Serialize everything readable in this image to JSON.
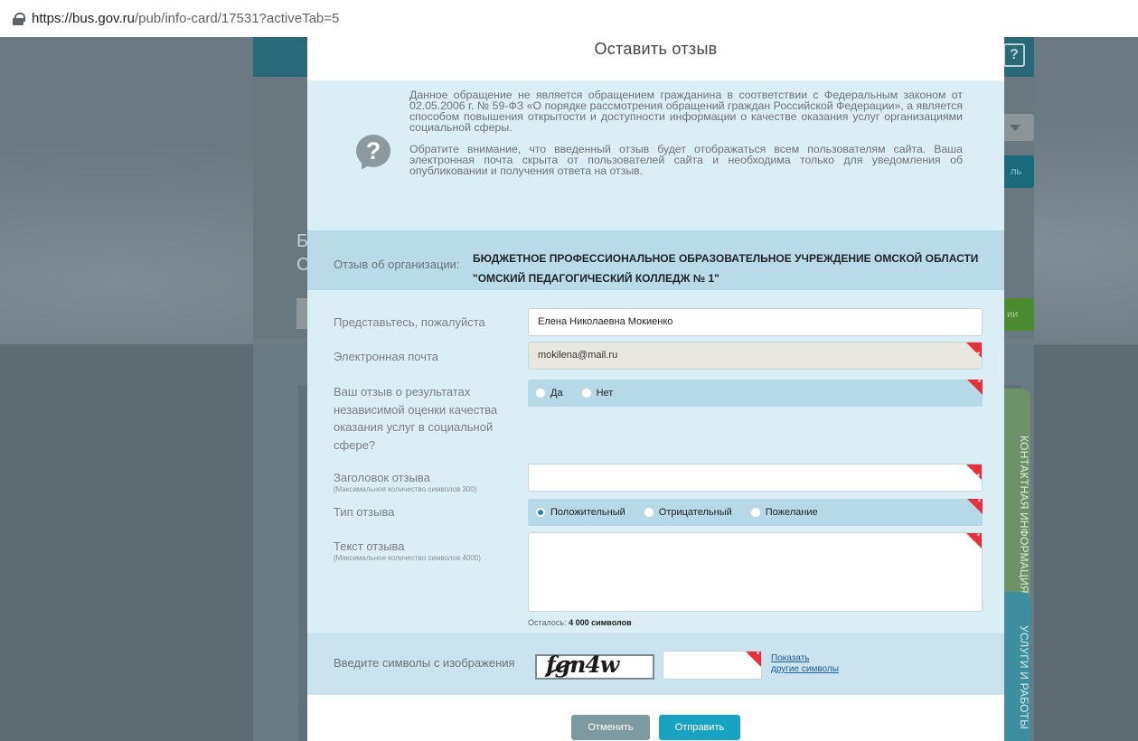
{
  "browser": {
    "url_host": "https://bus.gov.ru",
    "url_path": "/pub/info-card/17531?activeTab=5"
  },
  "background": {
    "letters": "Б\nС",
    "button_fragment_1": "ль",
    "button_fragment_2": "ии",
    "side_tabs": [
      "КОНТАКТНАЯ ИНФОРМАЦИЯ",
      "УСЛУГИ И РАБОТЫ"
    ]
  },
  "modal": {
    "title": "Оставить отзыв",
    "notice": {
      "paragraph_1": "Данное обращение не является обращением гражданина в соответствии с Федеральным законом от 02.05.2006 г. № 59-ФЗ «О порядке рассмотрения обращений граждан Российской Федерации», а является способом повышения открытости и доступности информации о качестве оказания услуг организациями социальной сферы.",
      "paragraph_2": "Обратите внимание, что введенный отзыв будет отображаться всем пользователям сайта. Ваша электронная почта скрыта от пользователей сайта и необходима только для уведомления об опубликовании и получения ответа на отзыв."
    },
    "organization": {
      "label": "Отзыв об организации:",
      "line_1": "БЮДЖЕТНОЕ ПРОФЕССИОНАЛЬНОЕ ОБРАЗОВАТЕЛЬНОЕ УЧРЕЖДЕНИЕ ОМСКОЙ ОБЛАСТИ",
      "line_2": "\"ОМСКИЙ ПЕДАГОГИЧЕСКИЙ КОЛЛЕДЖ № 1\""
    },
    "form": {
      "name_label": "Представьтесь, пожалуйста",
      "name_value": "Елена Николаевна Мокиенко",
      "email_label": "Электронная почта",
      "email_value": "mokilena@mail.ru",
      "independent_label": "Ваш отзыв о результатах независимой оценки качества оказания услуг в социальной сфере?",
      "independent_options": [
        "Да",
        "Нет"
      ],
      "title_label": "Заголовок отзыва",
      "title_hint": "(Максимальное количество символов 300)",
      "title_value": "",
      "type_label": "Тип отзыва",
      "type_options": [
        "Положительный",
        "Отрицательный",
        "Пожелание"
      ],
      "type_selected": "Положительный",
      "text_label": "Текст отзыва",
      "text_hint": "(Максимальное количество символов 4000)",
      "text_value": "",
      "counter_prefix": "Осталось:",
      "counter_value": "4 000 символов"
    },
    "captcha": {
      "label": "Введите символы с изображения",
      "image_text": "fgn4w",
      "link_line_1": "Показать",
      "link_line_2": "другие символы"
    },
    "buttons": {
      "cancel": "Отменить",
      "send": "Отправить"
    }
  }
}
